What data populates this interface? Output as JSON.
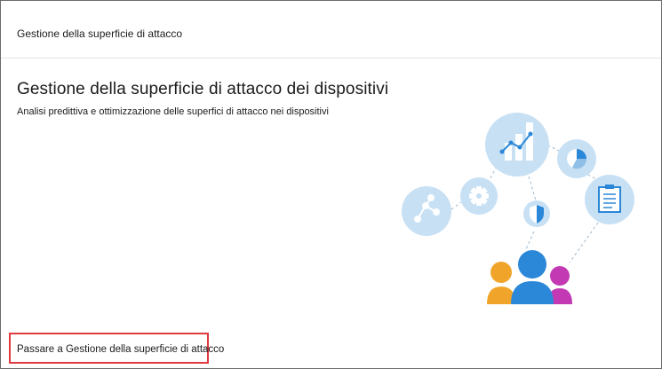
{
  "header": {
    "title": "Gestione della superficie di attacco"
  },
  "main": {
    "title": "Gestione della superficie di attacco dei dispositivi",
    "subtitle": "Analisi predittiva e ottimizzazione delle superfici di attacco nei dispositivi"
  },
  "footer": {
    "link_label": "Passare a Gestione della superficie di attacco"
  },
  "colors": {
    "circle": "#c7e0f4",
    "icon_blue": "#2b88d8",
    "person_center": "#2b88d8",
    "person_left": "#f0a52a",
    "person_right": "#c239b3",
    "highlight_box": "#e0393e"
  },
  "icons": [
    "network-icon",
    "gear-icon",
    "bar-line-chart-icon",
    "pie-chart-icon",
    "shield-icon",
    "clipboard-icon",
    "people-group-icon"
  ]
}
